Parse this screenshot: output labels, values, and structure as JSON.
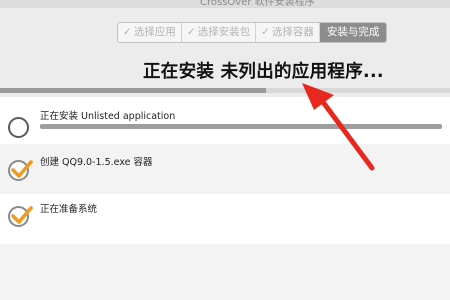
{
  "window": {
    "title": "CrossOver 软件安装程序"
  },
  "steps": [
    {
      "label": "选择应用",
      "completed": true
    },
    {
      "label": "选择安装包",
      "completed": true
    },
    {
      "label": "选择容器",
      "completed": true
    },
    {
      "label": "安装与完成",
      "completed": false,
      "active": true
    }
  ],
  "heading": "正在安装 未列出的应用程序...",
  "overall_progress": 0.59,
  "tasks": [
    {
      "label": "正在安装 Unlisted application",
      "status": "in-progress",
      "progress": 1.0
    },
    {
      "label": "创建 QQ9.0-1.5.exe 容器",
      "status": "done"
    },
    {
      "label": "正在准备系统",
      "status": "done"
    }
  ],
  "colors": {
    "check": "#f29a1e",
    "arrow": "#e8271f",
    "active_step": "#8d8d8d"
  },
  "icons": {
    "check": "check-mark",
    "pending": "empty-circle"
  }
}
